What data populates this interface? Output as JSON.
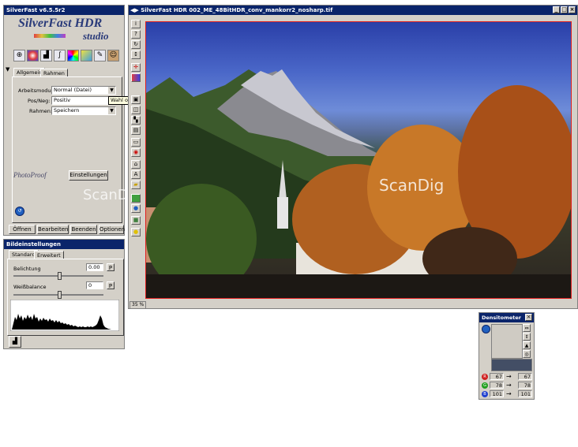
{
  "main_panel": {
    "title": "SilverFast v6.5.5r2",
    "logo_line1": "SilverFast HDR",
    "logo_line2": "studio",
    "tabs": [
      "Allgemein",
      "Rahmen"
    ],
    "arbeitsmodus_label": "Arbeitsmodus:",
    "arbeitsmodus_value": "Normal (Datei)",
    "posneg_label": "Pos/Neg:",
    "posneg_value": "Positiv",
    "rahmen_label": "Rahmen:",
    "rahmen_value": "Speichern",
    "tooltip": "Wahl ob Normal- oder Stapel-Scan",
    "photoproof_label": "PhotoProof",
    "einstellungen_button": "Einstellungen",
    "watermark": "ScanDig",
    "buttons": [
      "Öffnen",
      "Bearbeiten",
      "Beenden",
      "Optionen"
    ]
  },
  "bild_panel": {
    "title": "Bildeinstellungen",
    "tabs": [
      "Standard",
      "Erweitert"
    ],
    "belichtung_label": "Belichtung",
    "belichtung_value": "0.00",
    "weissbalance_label": "Weißbalance",
    "weissbalance_value": "0"
  },
  "image_window": {
    "title": "SilverFast HDR 002_ME_48BitHDR_conv_mankorr2_nosharp.tif",
    "watermark": "ScanDig",
    "zoom": "35 %"
  },
  "densitometer": {
    "title": "Densitometer",
    "rows": [
      {
        "channel": "R",
        "color": "#d02020",
        "before": "67",
        "after": "67"
      },
      {
        "channel": "G",
        "color": "#20a020",
        "before": "78",
        "after": "78"
      },
      {
        "channel": "B",
        "color": "#2040d0",
        "before": "101",
        "after": "101"
      }
    ],
    "arrow": "→"
  }
}
